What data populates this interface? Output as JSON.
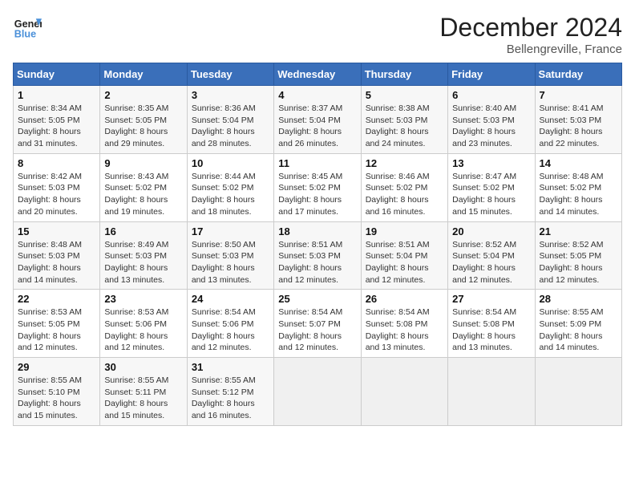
{
  "logo": {
    "text_general": "General",
    "text_blue": "Blue"
  },
  "header": {
    "month": "December 2024",
    "location": "Bellengreville, France"
  },
  "weekdays": [
    "Sunday",
    "Monday",
    "Tuesday",
    "Wednesday",
    "Thursday",
    "Friday",
    "Saturday"
  ],
  "weeks": [
    [
      {
        "day": 1,
        "sunrise": "8:34 AM",
        "sunset": "5:05 PM",
        "daylight": "8 hours and 31 minutes"
      },
      {
        "day": 2,
        "sunrise": "8:35 AM",
        "sunset": "5:05 PM",
        "daylight": "8 hours and 29 minutes"
      },
      {
        "day": 3,
        "sunrise": "8:36 AM",
        "sunset": "5:04 PM",
        "daylight": "8 hours and 28 minutes"
      },
      {
        "day": 4,
        "sunrise": "8:37 AM",
        "sunset": "5:04 PM",
        "daylight": "8 hours and 26 minutes"
      },
      {
        "day": 5,
        "sunrise": "8:38 AM",
        "sunset": "5:03 PM",
        "daylight": "8 hours and 24 minutes"
      },
      {
        "day": 6,
        "sunrise": "8:40 AM",
        "sunset": "5:03 PM",
        "daylight": "8 hours and 23 minutes"
      },
      {
        "day": 7,
        "sunrise": "8:41 AM",
        "sunset": "5:03 PM",
        "daylight": "8 hours and 22 minutes"
      }
    ],
    [
      {
        "day": 8,
        "sunrise": "8:42 AM",
        "sunset": "5:03 PM",
        "daylight": "8 hours and 20 minutes"
      },
      {
        "day": 9,
        "sunrise": "8:43 AM",
        "sunset": "5:02 PM",
        "daylight": "8 hours and 19 minutes"
      },
      {
        "day": 10,
        "sunrise": "8:44 AM",
        "sunset": "5:02 PM",
        "daylight": "8 hours and 18 minutes"
      },
      {
        "day": 11,
        "sunrise": "8:45 AM",
        "sunset": "5:02 PM",
        "daylight": "8 hours and 17 minutes"
      },
      {
        "day": 12,
        "sunrise": "8:46 AM",
        "sunset": "5:02 PM",
        "daylight": "8 hours and 16 minutes"
      },
      {
        "day": 13,
        "sunrise": "8:47 AM",
        "sunset": "5:02 PM",
        "daylight": "8 hours and 15 minutes"
      },
      {
        "day": 14,
        "sunrise": "8:48 AM",
        "sunset": "5:02 PM",
        "daylight": "8 hours and 14 minutes"
      }
    ],
    [
      {
        "day": 15,
        "sunrise": "8:48 AM",
        "sunset": "5:03 PM",
        "daylight": "8 hours and 14 minutes"
      },
      {
        "day": 16,
        "sunrise": "8:49 AM",
        "sunset": "5:03 PM",
        "daylight": "8 hours and 13 minutes"
      },
      {
        "day": 17,
        "sunrise": "8:50 AM",
        "sunset": "5:03 PM",
        "daylight": "8 hours and 13 minutes"
      },
      {
        "day": 18,
        "sunrise": "8:51 AM",
        "sunset": "5:03 PM",
        "daylight": "8 hours and 12 minutes"
      },
      {
        "day": 19,
        "sunrise": "8:51 AM",
        "sunset": "5:04 PM",
        "daylight": "8 hours and 12 minutes"
      },
      {
        "day": 20,
        "sunrise": "8:52 AM",
        "sunset": "5:04 PM",
        "daylight": "8 hours and 12 minutes"
      },
      {
        "day": 21,
        "sunrise": "8:52 AM",
        "sunset": "5:05 PM",
        "daylight": "8 hours and 12 minutes"
      }
    ],
    [
      {
        "day": 22,
        "sunrise": "8:53 AM",
        "sunset": "5:05 PM",
        "daylight": "8 hours and 12 minutes"
      },
      {
        "day": 23,
        "sunrise": "8:53 AM",
        "sunset": "5:06 PM",
        "daylight": "8 hours and 12 minutes"
      },
      {
        "day": 24,
        "sunrise": "8:54 AM",
        "sunset": "5:06 PM",
        "daylight": "8 hours and 12 minutes"
      },
      {
        "day": 25,
        "sunrise": "8:54 AM",
        "sunset": "5:07 PM",
        "daylight": "8 hours and 12 minutes"
      },
      {
        "day": 26,
        "sunrise": "8:54 AM",
        "sunset": "5:08 PM",
        "daylight": "8 hours and 13 minutes"
      },
      {
        "day": 27,
        "sunrise": "8:54 AM",
        "sunset": "5:08 PM",
        "daylight": "8 hours and 13 minutes"
      },
      {
        "day": 28,
        "sunrise": "8:55 AM",
        "sunset": "5:09 PM",
        "daylight": "8 hours and 14 minutes"
      }
    ],
    [
      {
        "day": 29,
        "sunrise": "8:55 AM",
        "sunset": "5:10 PM",
        "daylight": "8 hours and 15 minutes"
      },
      {
        "day": 30,
        "sunrise": "8:55 AM",
        "sunset": "5:11 PM",
        "daylight": "8 hours and 15 minutes"
      },
      {
        "day": 31,
        "sunrise": "8:55 AM",
        "sunset": "5:12 PM",
        "daylight": "8 hours and 16 minutes"
      },
      null,
      null,
      null,
      null
    ]
  ]
}
